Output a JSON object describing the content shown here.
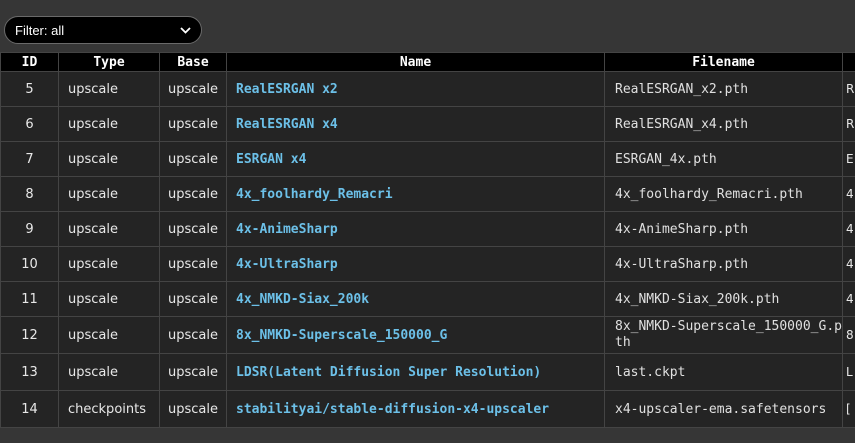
{
  "filter": {
    "label": "Filter: all",
    "icon": "chevron-down-icon"
  },
  "table": {
    "headers": [
      "ID",
      "Type",
      "Base",
      "Name",
      "Filename",
      ""
    ],
    "rows": [
      {
        "id": "5",
        "type": "upscale",
        "base": "upscale",
        "name": "RealESRGAN x2",
        "file": "RealESRGAN_x2.pth",
        "extra": "R"
      },
      {
        "id": "6",
        "type": "upscale",
        "base": "upscale",
        "name": "RealESRGAN x4",
        "file": "RealESRGAN_x4.pth",
        "extra": "R"
      },
      {
        "id": "7",
        "type": "upscale",
        "base": "upscale",
        "name": "ESRGAN x4",
        "file": "ESRGAN_4x.pth",
        "extra": "E"
      },
      {
        "id": "8",
        "type": "upscale",
        "base": "upscale",
        "name": "4x_foolhardy_Remacri",
        "file": "4x_foolhardy_Remacri.pth",
        "extra": "4"
      },
      {
        "id": "9",
        "type": "upscale",
        "base": "upscale",
        "name": "4x-AnimeSharp",
        "file": "4x-AnimeSharp.pth",
        "extra": "4"
      },
      {
        "id": "10",
        "type": "upscale",
        "base": "upscale",
        "name": "4x-UltraSharp",
        "file": "4x-UltraSharp.pth",
        "extra": "4"
      },
      {
        "id": "11",
        "type": "upscale",
        "base": "upscale",
        "name": "4x_NMKD-Siax_200k",
        "file": "4x_NMKD-Siax_200k.pth",
        "extra": "4"
      },
      {
        "id": "12",
        "type": "upscale",
        "base": "upscale",
        "name": "8x_NMKD-Superscale_150000_G",
        "file": "8x_NMKD-Superscale_150000_G.pth",
        "extra": "8"
      },
      {
        "id": "13",
        "type": "upscale",
        "base": "upscale",
        "name": "LDSR(Latent Diffusion Super Resolution)",
        "file": "last.ckpt",
        "extra": "L p"
      },
      {
        "id": "14",
        "type": "checkpoints",
        "base": "upscale",
        "name": "stabilityai/stable-diffusion-x4-upscaler",
        "file": "x4-upscaler-ema.safetensors",
        "extra": "[ a"
      }
    ]
  },
  "colors": {
    "background": "#363636",
    "header_bg": "#000000",
    "cell_bg": "#242424",
    "name_link": "#6cc0e8"
  }
}
